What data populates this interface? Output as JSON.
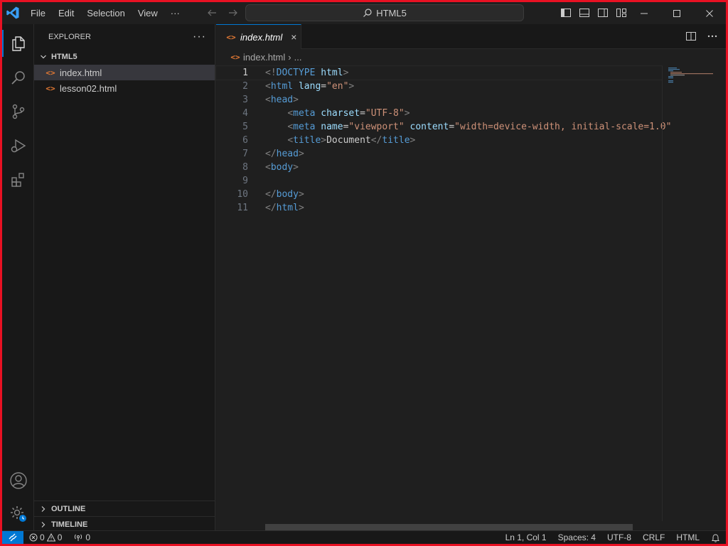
{
  "menu": [
    "File",
    "Edit",
    "Selection",
    "View",
    "···"
  ],
  "command_center": "HTML5",
  "sidebar": {
    "title": "EXPLORER",
    "more": "···",
    "folder": "HTML5",
    "files": [
      {
        "name": "index.html",
        "selected": true
      },
      {
        "name": "lesson02.html",
        "selected": false
      }
    ],
    "outline": "OUTLINE",
    "timeline": "TIMELINE"
  },
  "tab": {
    "label": "index.html",
    "close": "×"
  },
  "breadcrumb": {
    "file": "index.html",
    "sep": "›",
    "rest": "..."
  },
  "editor": {
    "line_numbers": [
      "1",
      "2",
      "3",
      "4",
      "5",
      "6",
      "7",
      "8",
      "9",
      "10",
      "11"
    ],
    "lines": [
      [
        [
          "br",
          "<!"
        ],
        [
          "tag",
          "DOCTYPE"
        ],
        [
          "txt",
          " "
        ],
        [
          "attr",
          "html"
        ],
        [
          "br",
          ">"
        ]
      ],
      [
        [
          "br",
          "<"
        ],
        [
          "tag",
          "html"
        ],
        [
          "txt",
          " "
        ],
        [
          "attr",
          "lang"
        ],
        [
          "txt",
          "="
        ],
        [
          "str",
          "\"en\""
        ],
        [
          "br",
          ">"
        ]
      ],
      [
        [
          "br",
          "<"
        ],
        [
          "tag",
          "head"
        ],
        [
          "br",
          ">"
        ]
      ],
      [
        [
          "txt",
          "    "
        ],
        [
          "br",
          "<"
        ],
        [
          "tag",
          "meta"
        ],
        [
          "txt",
          " "
        ],
        [
          "attr",
          "charset"
        ],
        [
          "txt",
          "="
        ],
        [
          "str",
          "\"UTF-8\""
        ],
        [
          "br",
          ">"
        ]
      ],
      [
        [
          "txt",
          "    "
        ],
        [
          "br",
          "<"
        ],
        [
          "tag",
          "meta"
        ],
        [
          "txt",
          " "
        ],
        [
          "attr",
          "name"
        ],
        [
          "txt",
          "="
        ],
        [
          "str",
          "\"viewport\""
        ],
        [
          "txt",
          " "
        ],
        [
          "attr",
          "content"
        ],
        [
          "txt",
          "="
        ],
        [
          "str",
          "\"width=device-width, initial-scale=1.0\""
        ]
      ],
      [
        [
          "txt",
          "    "
        ],
        [
          "br",
          "<"
        ],
        [
          "tag",
          "title"
        ],
        [
          "br",
          ">"
        ],
        [
          "txt",
          "Document"
        ],
        [
          "br",
          "</"
        ],
        [
          "tag",
          "title"
        ],
        [
          "br",
          ">"
        ]
      ],
      [
        [
          "br",
          "</"
        ],
        [
          "tag",
          "head"
        ],
        [
          "br",
          ">"
        ]
      ],
      [
        [
          "br",
          "<"
        ],
        [
          "tag",
          "body"
        ],
        [
          "br",
          ">"
        ]
      ],
      [],
      [
        [
          "br",
          "</"
        ],
        [
          "tag",
          "body"
        ],
        [
          "br",
          ">"
        ]
      ],
      [
        [
          "br",
          "</"
        ],
        [
          "tag",
          "html"
        ],
        [
          "br",
          ">"
        ]
      ]
    ]
  },
  "status": {
    "errors": "0",
    "warnings": "0",
    "ports": "0",
    "position": "Ln 1, Col 1",
    "spaces": "Spaces: 4",
    "encoding": "UTF-8",
    "eol": "CRLF",
    "language": "HTML"
  },
  "colors": {
    "accent": "#0078d4",
    "frame": "#e81123",
    "html_icon": "#e37933"
  }
}
